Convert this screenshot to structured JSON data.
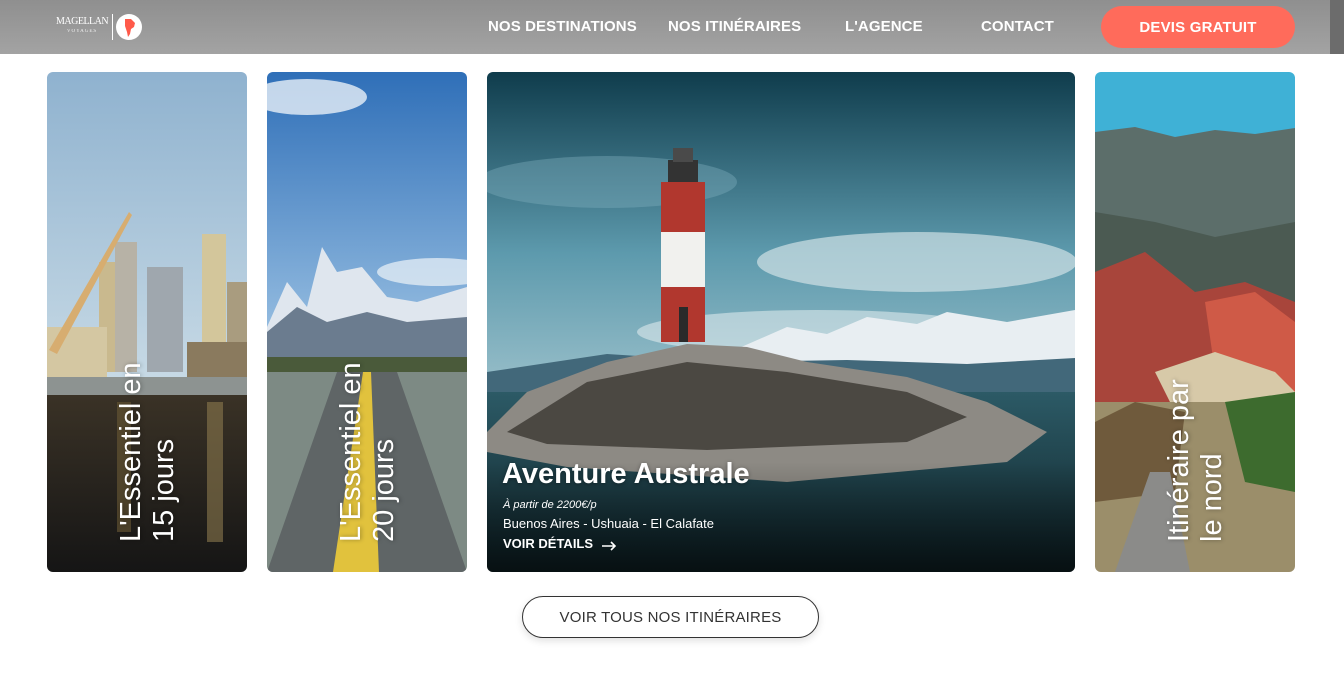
{
  "logo": {
    "text": "MAGELLAN",
    "sub": "VOYAGES"
  },
  "nav": {
    "destinations": "NOS DESTINATIONS",
    "itineraires": "NOS ITINÉRAIRES",
    "agence": "L'AGENCE",
    "contact": "CONTACT",
    "cta": "DEVIS GRATUIT"
  },
  "cards": [
    {
      "line1": "L'Essentiel en",
      "line2": "15 jours"
    },
    {
      "line1": "L'Essentiel en",
      "line2": "20 jours"
    },
    {
      "title": "Aventure Australe",
      "price": "À partir de 2200€/p",
      "route": "Buenos Aires - Ushuaia - El Calafate",
      "link": "VOIR DÉTAILS"
    },
    {
      "line1": "Itinéraire par",
      "line2": "le nord"
    }
  ],
  "all_button": "VOIR TOUS NOS ITINÉRAIRES",
  "colors": {
    "accent": "#ff6b5b",
    "header": "#9a9a9a"
  }
}
